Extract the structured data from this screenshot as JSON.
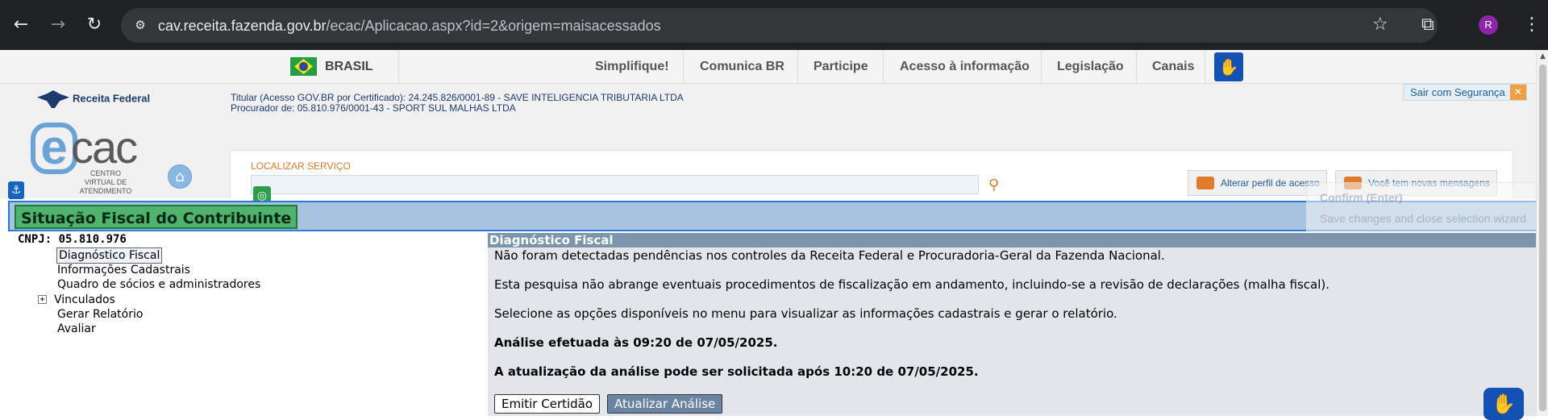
{
  "browser": {
    "url_host": "cav.receita.fazenda.gov.br",
    "url_path": "/ecac/Aplicacao.aspx?id=2&origem=maisacessados",
    "profile_initial": "R",
    "icons": [
      "back-icon",
      "forward-icon",
      "reload-icon",
      "site-info-icon",
      "star-icon",
      "extensions-icon",
      "menu-icon"
    ]
  },
  "govbar": {
    "country": "BRASIL",
    "links": [
      "Simplifique!",
      "Comunica BR",
      "Participe",
      "Acesso à informação",
      "Legislação",
      "Canais"
    ]
  },
  "header": {
    "rf_name": "Receita Federal",
    "ecac_sub": "CENTRO VIRTUAL DE ATENDIMENTO",
    "titular": "Titular (Acesso GOV.BR por Certificado): 24.245.826/0001-89 - SAVE INTELIGENCIA TRIBUTARIA LTDA",
    "procurador": "Procurador de: 05.810.976/0001-43 - SPORT SUL MALHAS LTDA",
    "sair": "Sair com Segurança",
    "search_label": "LOCALIZAR SERVIÇO",
    "alterar_perfil": "Alterar perfil de acesso",
    "mensagens": "Você tem novas mensagens"
  },
  "overlay": {
    "confirm_title": "Confirm (Enter)",
    "confirm_desc": "Save changes and close selection wizard"
  },
  "page": {
    "title": "Situação Fiscal do Contribuinte",
    "cnpj": "CNPJ: 05.810.976"
  },
  "tree": {
    "items": [
      "Diagnóstico Fiscal",
      "Informações Cadastrais",
      "Quadro de sócios e administradores",
      "Vinculados",
      "Gerar Relatório",
      "Avaliar"
    ]
  },
  "panel": {
    "header": "Diagnóstico Fiscal",
    "p1": "Não foram detectadas pendências nos controles da Receita Federal e Procuradoria-Geral da Fazenda Nacional.",
    "p2": "Esta pesquisa não abrange eventuais procedimentos de fiscalização em andamento, incluindo-se a revisão de declarações (malha fiscal).",
    "p3": "Selecione as opções disponíveis no menu para visualizar as informações cadastrais e gerar o relatório.",
    "p4": "Análise efetuada às 09:20 de 07/05/2025.",
    "p5": "A atualização da análise pode ser solicitada após 10:20 de 07/05/2025.",
    "btn_emitir": "Emitir Certidão",
    "btn_atualizar": "Atualizar Análise"
  }
}
